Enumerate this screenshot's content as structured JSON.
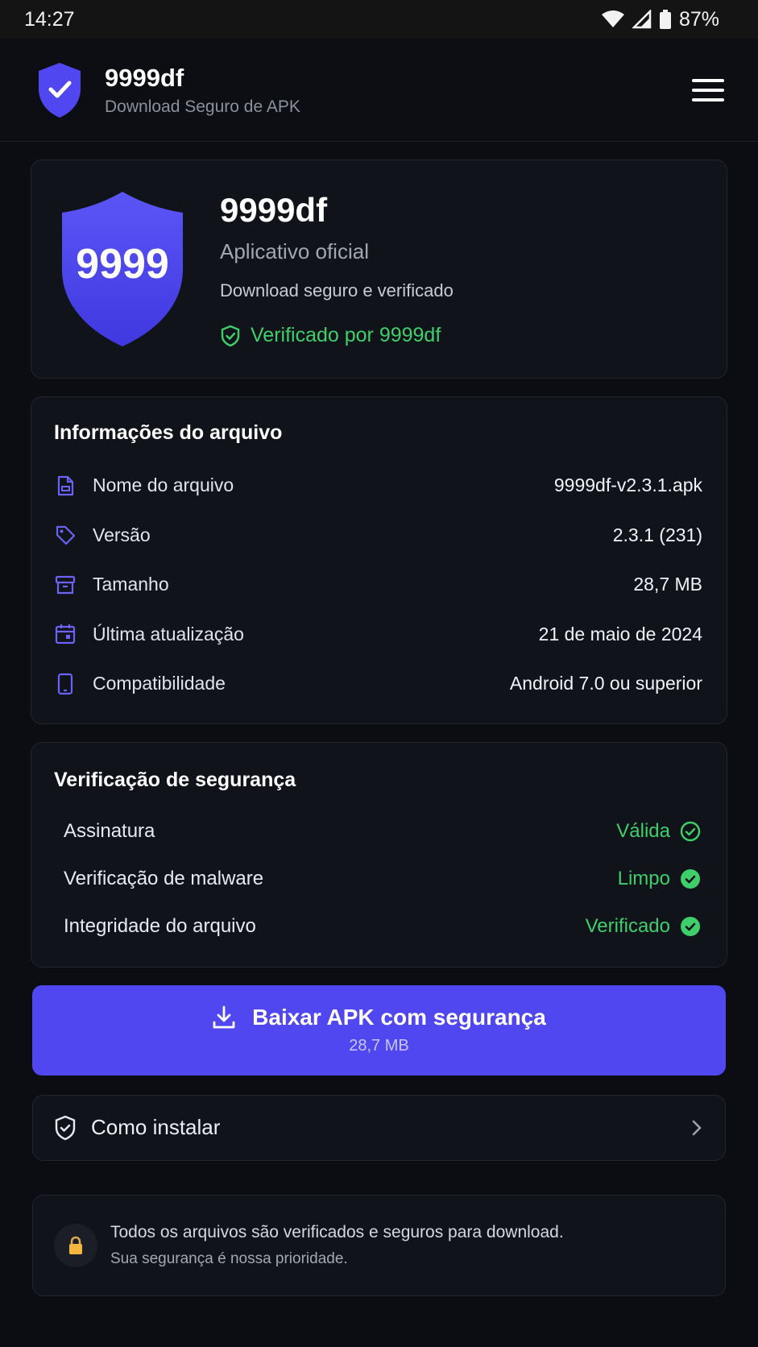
{
  "status_bar": {
    "time": "14:27",
    "battery": "87%"
  },
  "app_bar": {
    "title": "9999df",
    "subtitle": "Download Seguro de APK"
  },
  "hero": {
    "shield_text": "9999",
    "name": "9999df",
    "subtitle": "Aplicativo oficial",
    "description": "Download seguro e verificado",
    "verified": "Verificado por 9999df"
  },
  "file_info": {
    "title": "Informações do arquivo",
    "rows": [
      {
        "icon": "file-icon",
        "label": "Nome do arquivo",
        "value": "9999df-v2.3.1.apk"
      },
      {
        "icon": "tag-icon",
        "label": "Versão",
        "value": "2.3.1 (231)"
      },
      {
        "icon": "archive-icon",
        "label": "Tamanho",
        "value": "28,7 MB"
      },
      {
        "icon": "calendar-icon",
        "label": "Última atualização",
        "value": "21 de maio de 2024"
      },
      {
        "icon": "phone-icon",
        "label": "Compatibilidade",
        "value": "Android 7.0 ou superior"
      }
    ]
  },
  "security": {
    "title": "Verificação de segurança",
    "rows": [
      {
        "label": "Assinatura",
        "value": "Válida"
      },
      {
        "label": "Verificação de malware",
        "value": "Limpo"
      },
      {
        "label": "Integridade do arquivo",
        "value": "Verificado"
      }
    ]
  },
  "download": {
    "label": "Baixar APK com segurança",
    "size": "28,7 MB"
  },
  "install": {
    "label": "Como instalar"
  },
  "notice": {
    "line1": "Todos os arquivos são verificados e seguros para download.",
    "line2": "Sua segurança é nossa prioridade."
  },
  "colors": {
    "accent": "#5047f0",
    "success": "#3ecf6b",
    "background": "#0b0d12",
    "card": "#10131a"
  }
}
